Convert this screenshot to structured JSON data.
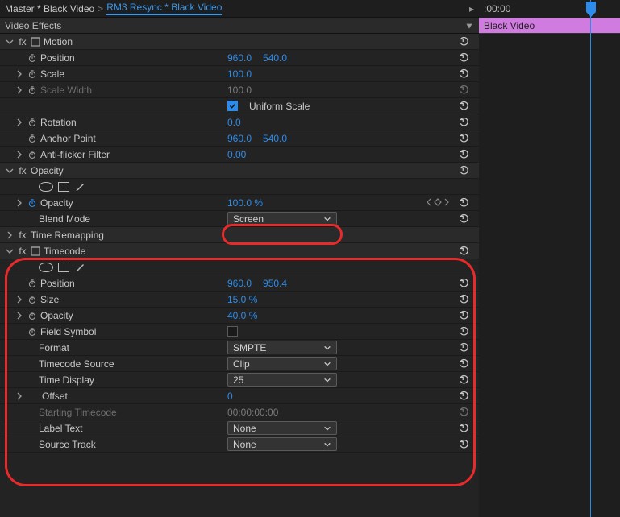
{
  "crumbs": {
    "master": "Master * Black Video",
    "clip": "RM3 Resync * Black Video"
  },
  "sectionTitle": "Video Effects",
  "timeline": {
    "time": ":00:00",
    "clipName": "Black Video"
  },
  "motion": {
    "label": "Motion",
    "position": {
      "label": "Position",
      "x": "960.0",
      "y": "540.0"
    },
    "scale": {
      "label": "Scale",
      "v": "100.0"
    },
    "scaleWidth": {
      "label": "Scale Width",
      "v": "100.0"
    },
    "uniform": {
      "label": "Uniform Scale"
    },
    "rotation": {
      "label": "Rotation",
      "v": "0.0"
    },
    "anchor": {
      "label": "Anchor Point",
      "x": "960.0",
      "y": "540.0"
    },
    "antiflicker": {
      "label": "Anti-flicker Filter",
      "v": "0.00"
    }
  },
  "opacity": {
    "label": "Opacity",
    "prop": {
      "label": "Opacity",
      "v": "100.0 %"
    },
    "blend": {
      "label": "Blend Mode",
      "v": "Screen"
    }
  },
  "timeRemap": {
    "label": "Time Remapping"
  },
  "timecode": {
    "label": "Timecode",
    "position": {
      "label": "Position",
      "x": "960.0",
      "y": "950.4"
    },
    "size": {
      "label": "Size",
      "v": "15.0 %"
    },
    "opacity": {
      "label": "Opacity",
      "v": "40.0 %"
    },
    "field": {
      "label": "Field Symbol"
    },
    "format": {
      "label": "Format",
      "v": "SMPTE"
    },
    "source": {
      "label": "Timecode Source",
      "v": "Clip"
    },
    "display": {
      "label": "Time Display",
      "v": "25"
    },
    "offset": {
      "label": "Offset",
      "v": "0"
    },
    "start": {
      "label": "Starting Timecode",
      "v": "00:00:00:00"
    },
    "labelText": {
      "label": "Label Text",
      "v": "None"
    },
    "track": {
      "label": "Source Track",
      "v": "None"
    }
  }
}
